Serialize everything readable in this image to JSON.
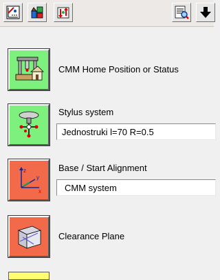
{
  "toolbar": {
    "buttons": [
      {
        "icon": "measure-tool-icon"
      },
      {
        "icon": "cmm-palette-icon"
      },
      {
        "icon": "probe-transfer-icon"
      },
      {
        "icon": "report-preview-icon"
      },
      {
        "icon": "arrow-down-icon"
      }
    ]
  },
  "colors": {
    "green": "#7ef07e",
    "red": "#f26a4a",
    "yellow": "#ffff70",
    "background": "#f0f0f0"
  },
  "rows": [
    {
      "label": "CMM Home Position or Status",
      "icon": "cmm-home-icon",
      "color": "#7ef07e"
    },
    {
      "label": "Stylus system",
      "icon": "stylus-icon",
      "color": "#7ef07e",
      "value": "Jednostruki l=70 R=0.5"
    },
    {
      "label": "Base / Start Alignment",
      "icon": "coordinate-axes-icon",
      "color": "#f26a4a",
      "value": "CMM system"
    },
    {
      "label": "Clearance Plane",
      "icon": "clearance-cube-icon",
      "color": "#f26a4a"
    }
  ]
}
